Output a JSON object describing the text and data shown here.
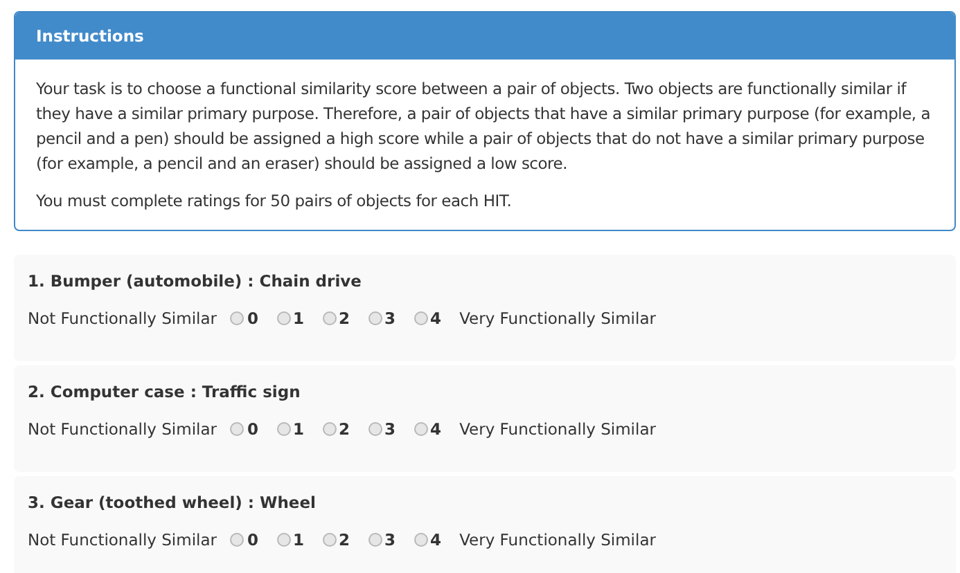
{
  "instructions": {
    "title": "Instructions",
    "paragraphs": [
      "Your task is to choose a functional similarity score between a pair of objects. Two objects are functionally similar if they have a similar primary purpose. Therefore, a pair of objects that have a similar primary purpose (for example, a pencil and a pen) should be assigned a high score while a pair of objects that do not have a similar primary purpose (for example, a pencil and an eraser) should be assigned a low score.",
      "You must complete ratings for 50 pairs of objects for each HIT."
    ]
  },
  "questions": [
    {
      "title": "1. Bumper (automobile) : Chain drive",
      "low_label": "Not Functionally Similar",
      "high_label": "Very Functionally Similar",
      "options": [
        {
          "label": "0",
          "selected": false
        },
        {
          "label": "1",
          "selected": false
        },
        {
          "label": "2",
          "selected": false
        },
        {
          "label": "3",
          "selected": false
        },
        {
          "label": "4",
          "selected": false
        }
      ]
    },
    {
      "title": "2. Computer case : Traffic sign",
      "low_label": "Not Functionally Similar",
      "high_label": "Very Functionally Similar",
      "options": [
        {
          "label": "0",
          "selected": false
        },
        {
          "label": "1",
          "selected": false
        },
        {
          "label": "2",
          "selected": false
        },
        {
          "label": "3",
          "selected": false
        },
        {
          "label": "4",
          "selected": false
        }
      ]
    },
    {
      "title": "3. Gear (toothed wheel) : Wheel",
      "low_label": "Not Functionally Similar",
      "high_label": "Very Functionally Similar",
      "options": [
        {
          "label": "0",
          "selected": false
        },
        {
          "label": "1",
          "selected": false
        },
        {
          "label": "2",
          "selected": false
        },
        {
          "label": "3",
          "selected": false
        },
        {
          "label": "4",
          "selected": false
        }
      ]
    }
  ]
}
